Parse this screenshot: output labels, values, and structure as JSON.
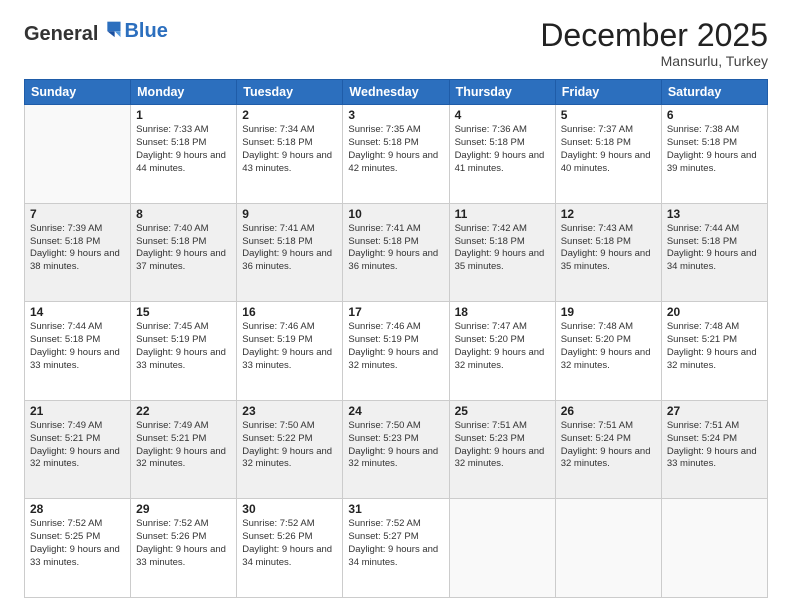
{
  "header": {
    "logo": {
      "general": "General",
      "blue": "Blue"
    },
    "title": "December 2025",
    "location": "Mansurlu, Turkey"
  },
  "days_of_week": [
    "Sunday",
    "Monday",
    "Tuesday",
    "Wednesday",
    "Thursday",
    "Friday",
    "Saturday"
  ],
  "weeks": [
    [
      {
        "day": null,
        "sunrise": null,
        "sunset": null,
        "daylight": null
      },
      {
        "day": "1",
        "sunrise": "Sunrise: 7:33 AM",
        "sunset": "Sunset: 5:18 PM",
        "daylight": "Daylight: 9 hours and 44 minutes."
      },
      {
        "day": "2",
        "sunrise": "Sunrise: 7:34 AM",
        "sunset": "Sunset: 5:18 PM",
        "daylight": "Daylight: 9 hours and 43 minutes."
      },
      {
        "day": "3",
        "sunrise": "Sunrise: 7:35 AM",
        "sunset": "Sunset: 5:18 PM",
        "daylight": "Daylight: 9 hours and 42 minutes."
      },
      {
        "day": "4",
        "sunrise": "Sunrise: 7:36 AM",
        "sunset": "Sunset: 5:18 PM",
        "daylight": "Daylight: 9 hours and 41 minutes."
      },
      {
        "day": "5",
        "sunrise": "Sunrise: 7:37 AM",
        "sunset": "Sunset: 5:18 PM",
        "daylight": "Daylight: 9 hours and 40 minutes."
      },
      {
        "day": "6",
        "sunrise": "Sunrise: 7:38 AM",
        "sunset": "Sunset: 5:18 PM",
        "daylight": "Daylight: 9 hours and 39 minutes."
      }
    ],
    [
      {
        "day": "7",
        "sunrise": "Sunrise: 7:39 AM",
        "sunset": "Sunset: 5:18 PM",
        "daylight": "Daylight: 9 hours and 38 minutes."
      },
      {
        "day": "8",
        "sunrise": "Sunrise: 7:40 AM",
        "sunset": "Sunset: 5:18 PM",
        "daylight": "Daylight: 9 hours and 37 minutes."
      },
      {
        "day": "9",
        "sunrise": "Sunrise: 7:41 AM",
        "sunset": "Sunset: 5:18 PM",
        "daylight": "Daylight: 9 hours and 36 minutes."
      },
      {
        "day": "10",
        "sunrise": "Sunrise: 7:41 AM",
        "sunset": "Sunset: 5:18 PM",
        "daylight": "Daylight: 9 hours and 36 minutes."
      },
      {
        "day": "11",
        "sunrise": "Sunrise: 7:42 AM",
        "sunset": "Sunset: 5:18 PM",
        "daylight": "Daylight: 9 hours and 35 minutes."
      },
      {
        "day": "12",
        "sunrise": "Sunrise: 7:43 AM",
        "sunset": "Sunset: 5:18 PM",
        "daylight": "Daylight: 9 hours and 35 minutes."
      },
      {
        "day": "13",
        "sunrise": "Sunrise: 7:44 AM",
        "sunset": "Sunset: 5:18 PM",
        "daylight": "Daylight: 9 hours and 34 minutes."
      }
    ],
    [
      {
        "day": "14",
        "sunrise": "Sunrise: 7:44 AM",
        "sunset": "Sunset: 5:18 PM",
        "daylight": "Daylight: 9 hours and 33 minutes."
      },
      {
        "day": "15",
        "sunrise": "Sunrise: 7:45 AM",
        "sunset": "Sunset: 5:19 PM",
        "daylight": "Daylight: 9 hours and 33 minutes."
      },
      {
        "day": "16",
        "sunrise": "Sunrise: 7:46 AM",
        "sunset": "Sunset: 5:19 PM",
        "daylight": "Daylight: 9 hours and 33 minutes."
      },
      {
        "day": "17",
        "sunrise": "Sunrise: 7:46 AM",
        "sunset": "Sunset: 5:19 PM",
        "daylight": "Daylight: 9 hours and 32 minutes."
      },
      {
        "day": "18",
        "sunrise": "Sunrise: 7:47 AM",
        "sunset": "Sunset: 5:20 PM",
        "daylight": "Daylight: 9 hours and 32 minutes."
      },
      {
        "day": "19",
        "sunrise": "Sunrise: 7:48 AM",
        "sunset": "Sunset: 5:20 PM",
        "daylight": "Daylight: 9 hours and 32 minutes."
      },
      {
        "day": "20",
        "sunrise": "Sunrise: 7:48 AM",
        "sunset": "Sunset: 5:21 PM",
        "daylight": "Daylight: 9 hours and 32 minutes."
      }
    ],
    [
      {
        "day": "21",
        "sunrise": "Sunrise: 7:49 AM",
        "sunset": "Sunset: 5:21 PM",
        "daylight": "Daylight: 9 hours and 32 minutes."
      },
      {
        "day": "22",
        "sunrise": "Sunrise: 7:49 AM",
        "sunset": "Sunset: 5:21 PM",
        "daylight": "Daylight: 9 hours and 32 minutes."
      },
      {
        "day": "23",
        "sunrise": "Sunrise: 7:50 AM",
        "sunset": "Sunset: 5:22 PM",
        "daylight": "Daylight: 9 hours and 32 minutes."
      },
      {
        "day": "24",
        "sunrise": "Sunrise: 7:50 AM",
        "sunset": "Sunset: 5:23 PM",
        "daylight": "Daylight: 9 hours and 32 minutes."
      },
      {
        "day": "25",
        "sunrise": "Sunrise: 7:51 AM",
        "sunset": "Sunset: 5:23 PM",
        "daylight": "Daylight: 9 hours and 32 minutes."
      },
      {
        "day": "26",
        "sunrise": "Sunrise: 7:51 AM",
        "sunset": "Sunset: 5:24 PM",
        "daylight": "Daylight: 9 hours and 32 minutes."
      },
      {
        "day": "27",
        "sunrise": "Sunrise: 7:51 AM",
        "sunset": "Sunset: 5:24 PM",
        "daylight": "Daylight: 9 hours and 33 minutes."
      }
    ],
    [
      {
        "day": "28",
        "sunrise": "Sunrise: 7:52 AM",
        "sunset": "Sunset: 5:25 PM",
        "daylight": "Daylight: 9 hours and 33 minutes."
      },
      {
        "day": "29",
        "sunrise": "Sunrise: 7:52 AM",
        "sunset": "Sunset: 5:26 PM",
        "daylight": "Daylight: 9 hours and 33 minutes."
      },
      {
        "day": "30",
        "sunrise": "Sunrise: 7:52 AM",
        "sunset": "Sunset: 5:26 PM",
        "daylight": "Daylight: 9 hours and 34 minutes."
      },
      {
        "day": "31",
        "sunrise": "Sunrise: 7:52 AM",
        "sunset": "Sunset: 5:27 PM",
        "daylight": "Daylight: 9 hours and 34 minutes."
      },
      {
        "day": null,
        "sunrise": null,
        "sunset": null,
        "daylight": null
      },
      {
        "day": null,
        "sunrise": null,
        "sunset": null,
        "daylight": null
      },
      {
        "day": null,
        "sunrise": null,
        "sunset": null,
        "daylight": null
      }
    ]
  ]
}
